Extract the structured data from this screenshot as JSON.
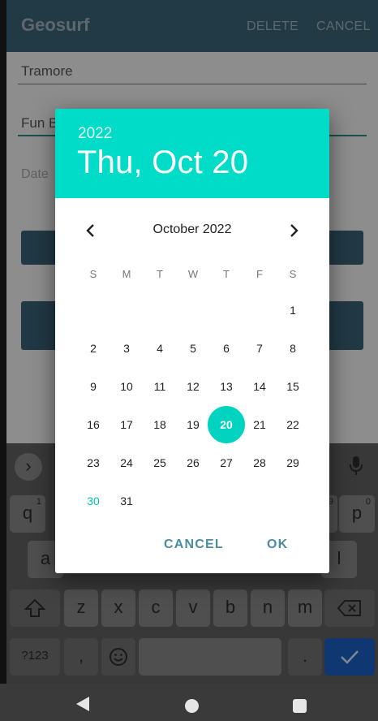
{
  "app": {
    "title": "Geosurf",
    "delete_label": "DELETE",
    "cancel_label": "CANCEL",
    "name_value": "Tramore",
    "description_value": "Fun B",
    "date_hint": "Date"
  },
  "keyboard": {
    "row1": [
      {
        "label": "q",
        "hint": "1"
      },
      {
        "label": "p",
        "hint": "0"
      }
    ],
    "hidden_hint_o": "9",
    "row2": [
      {
        "label": "a"
      },
      {
        "label": "l"
      }
    ],
    "row3": [
      "z",
      "x",
      "c",
      "v",
      "b",
      "n",
      "m"
    ],
    "row4": {
      "symbols": "?123",
      "comma": ",",
      "period": "."
    },
    "icons": [
      "chevron-right-icon",
      "mic-icon",
      "shift-icon",
      "backspace-icon",
      "emoji-icon",
      "check-icon"
    ]
  },
  "date_picker": {
    "header_year": "2022",
    "header_date": "Thu, Oct 20",
    "month_label": "October 2022",
    "weekdays": [
      "S",
      "M",
      "T",
      "W",
      "T",
      "F",
      "S"
    ],
    "first_weekday_index": 6,
    "days_in_month": 31,
    "selected_day": 20,
    "today_day": 30,
    "cancel_label": "CANCEL",
    "ok_label": "OK"
  },
  "colors": {
    "header": "#00dcc8",
    "selected": "#00d4c0",
    "action_text": "#4b8da0",
    "app_bar": "#3c6479",
    "enter_key": "#1a5fc4"
  }
}
